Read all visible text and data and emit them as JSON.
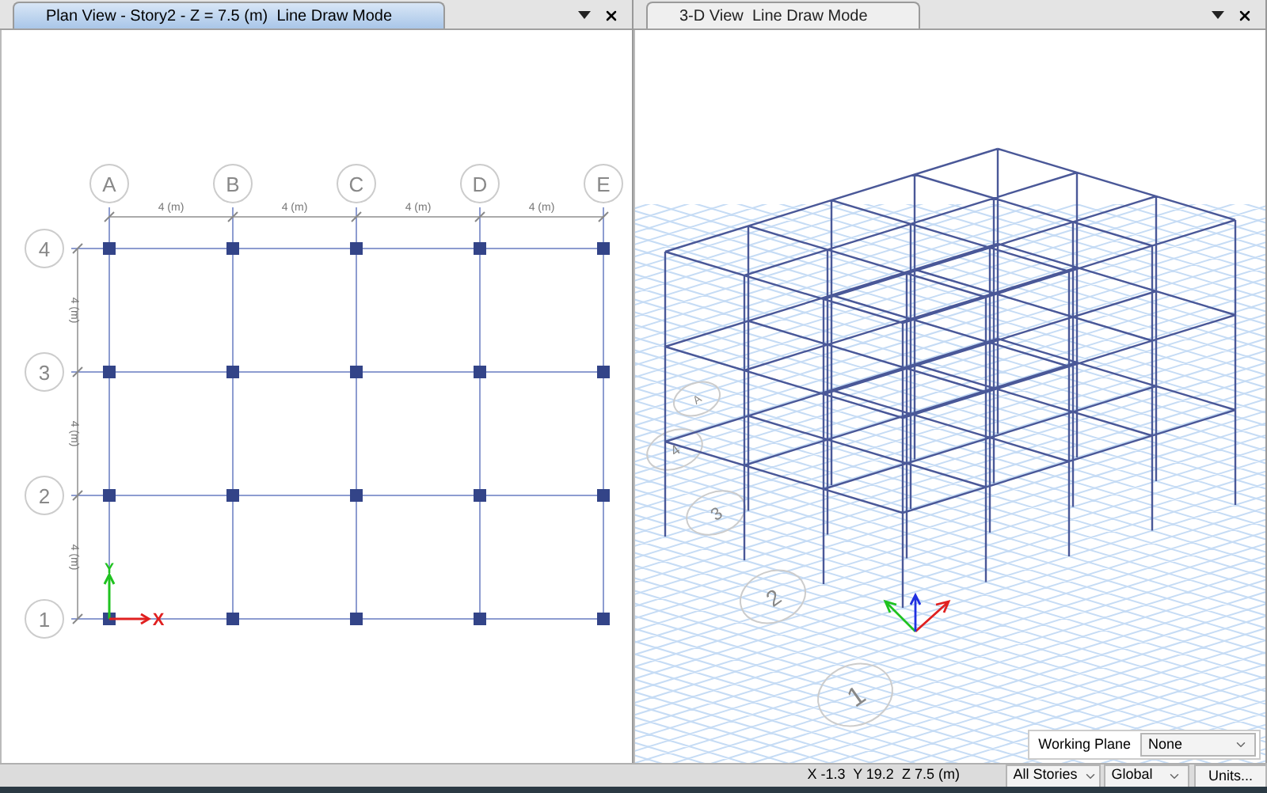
{
  "panels": [
    {
      "kind": "plan",
      "title": "Plan View - Story2 - Z = 7.5 (m)  Line Draw Mode",
      "selected": true
    },
    {
      "kind": "perspective",
      "title": "3-D View  Line Draw Mode",
      "selected": false
    }
  ],
  "plan": {
    "grid_columns": [
      "A",
      "B",
      "C",
      "D",
      "E"
    ],
    "grid_rows": [
      "4",
      "3",
      "2",
      "1"
    ],
    "column_spacings": [
      "4 (m)",
      "4 (m)",
      "4 (m)",
      "4 (m)"
    ],
    "row_spacings": [
      "4 (m)",
      "4 (m)",
      "4 (m)"
    ],
    "axes": {
      "x": "X",
      "y": "Y"
    }
  },
  "view_3d": {
    "grid_bubbles": [
      "A",
      "4",
      "3",
      "2",
      "1"
    ]
  },
  "working_plane": {
    "label": "Working Plane",
    "value": "None"
  },
  "status_bar": {
    "coordinates": "X -1.3  Y 19.2  Z 7.5 (m)",
    "stories": "All Stories",
    "system": "Global",
    "units_button": "Units..."
  }
}
